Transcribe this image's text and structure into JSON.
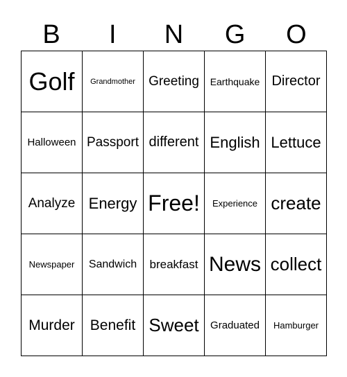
{
  "header": [
    "B",
    "I",
    "N",
    "G",
    "O"
  ],
  "cells": [
    [
      "Golf",
      "Grandmother",
      "Greeting",
      "Earthquake",
      "Director"
    ],
    [
      "Halloween",
      "Passport",
      "different",
      "English",
      "Lettuce"
    ],
    [
      "Analyze",
      "Energy",
      "Free!",
      "Experience",
      "create"
    ],
    [
      "Newspaper",
      "Sandwich",
      "breakfast",
      "News",
      "collect"
    ],
    [
      "Murder",
      "Benefit",
      "Sweet",
      "Graduated",
      "Hamburger"
    ]
  ]
}
